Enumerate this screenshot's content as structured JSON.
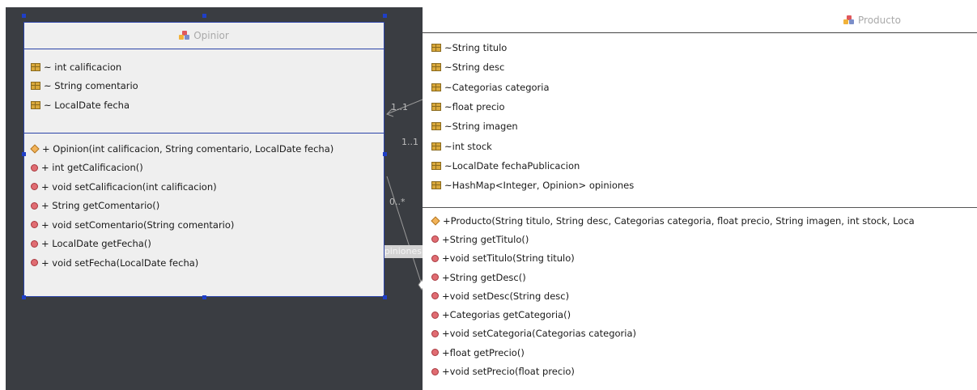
{
  "opinion": {
    "title": "Opinior",
    "attributes": [
      "~ int calificacion",
      "~ String comentario",
      "~ LocalDate fecha"
    ],
    "methods": [
      {
        "kind": "constructor",
        "text": "+ Opinion(int calificacion, String comentario, LocalDate fecha)"
      },
      {
        "kind": "method",
        "text": "+ int getCalificacion()"
      },
      {
        "kind": "method",
        "text": "+ void setCalificacion(int calificacion)"
      },
      {
        "kind": "method",
        "text": "+ String getComentario()"
      },
      {
        "kind": "method",
        "text": "+ void setComentario(String comentario)"
      },
      {
        "kind": "method",
        "text": "+ LocalDate getFecha()"
      },
      {
        "kind": "method",
        "text": "+ void setFecha(LocalDate fecha)"
      }
    ]
  },
  "producto": {
    "title": "Producto",
    "attributes": [
      "~String titulo",
      "~String desc",
      "~Categorias categoria",
      "~float precio",
      "~String imagen",
      "~int stock",
      "~LocalDate fechaPublicacion",
      "~HashMap<Integer, Opinion> opiniones"
    ],
    "methods": [
      {
        "kind": "constructor",
        "text": "+Producto(String titulo, String desc, Categorias categoria, float precio, String imagen, int stock, Loca"
      },
      {
        "kind": "method",
        "text": "+String getTitulo()"
      },
      {
        "kind": "method",
        "text": "+void setTitulo(String titulo)"
      },
      {
        "kind": "method",
        "text": "+String getDesc()"
      },
      {
        "kind": "method",
        "text": "+void setDesc(String desc)"
      },
      {
        "kind": "method",
        "text": "+Categorias getCategoria()"
      },
      {
        "kind": "method",
        "text": "+void setCategoria(Categorias categoria)"
      },
      {
        "kind": "method",
        "text": "+float getPrecio()"
      },
      {
        "kind": "method",
        "text": "+void setPrecio(float precio)"
      }
    ]
  },
  "association": {
    "label": "opiniones",
    "multiplicities": [
      "1..1",
      "1..1",
      "0..*"
    ]
  },
  "colors": {
    "canvas": "#3a3d42",
    "selection": "#2b43a8",
    "field_icon": "#d9a83a",
    "method_icon": "#e06c72",
    "constructor_icon": "#f2b35a"
  },
  "icons": {
    "class": "class-icon",
    "field": "field-icon",
    "method": "method-icon",
    "constructor": "constructor-icon"
  }
}
